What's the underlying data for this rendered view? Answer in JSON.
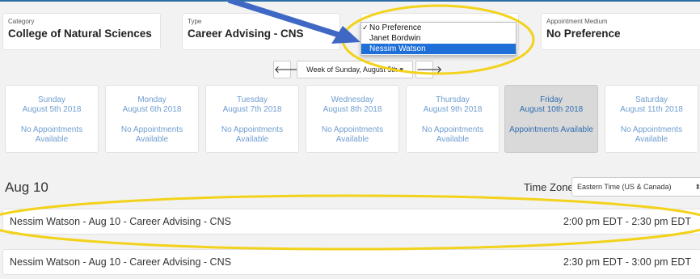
{
  "filters": {
    "category": {
      "label": "Category",
      "value": "College of Natural Sciences"
    },
    "type": {
      "label": "Type",
      "value": "Career Advising - CNS"
    },
    "medium": {
      "label": "Appointment Medium",
      "value": "No Preference"
    }
  },
  "staff_dropdown": {
    "options": [
      "No Preference",
      "Janet Bordwin",
      "Nessim Watson"
    ],
    "checked": "No Preference",
    "highlighted": "Nessim Watson"
  },
  "week_nav": {
    "prev_icon": "left-arrow-icon",
    "next_icon": "right-arrow-icon",
    "prev": "🡐",
    "next": "🡒",
    "week_label": "Week of Sunday, August 5th ▾"
  },
  "days": [
    {
      "name": "Sunday",
      "date": "August 5th 2018",
      "status": "No Appointments Available"
    },
    {
      "name": "Monday",
      "date": "August 6th 2018",
      "status": "No Appointments Available"
    },
    {
      "name": "Tuesday",
      "date": "August 7th 2018",
      "status": "No Appointments Available"
    },
    {
      "name": "Wednesday",
      "date": "August 8th 2018",
      "status": "No Appointments Available"
    },
    {
      "name": "Thursday",
      "date": "August 9th 2018",
      "status": "No Appointments Available"
    },
    {
      "name": "Friday",
      "date": "August 10th 2018",
      "status": "Appointments Available"
    },
    {
      "name": "Saturday",
      "date": "August 11th 2018",
      "status": "No Appointments Available"
    }
  ],
  "selected_date": "Aug 10",
  "timezone": {
    "label": "Time Zone:",
    "value": "Eastern Time (US & Canada)"
  },
  "appointments": [
    {
      "title": "Nessim Watson - Aug 10 - Career Advising - CNS",
      "time": "2:00 pm EDT - 2:30 pm EDT"
    },
    {
      "title": "Nessim Watson - Aug 10 - Career Advising - CNS",
      "time": "2:30 pm EDT - 3:00 pm EDT"
    }
  ],
  "colors": {
    "accent": "#2e6fa7",
    "annotation": "#f2d21b",
    "day_text": "#6f9ed0",
    "arrow": "#3f67c4"
  }
}
